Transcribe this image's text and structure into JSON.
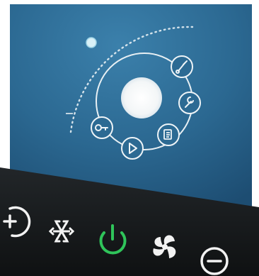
{
  "screen": {
    "dial": {
      "level": 0.25,
      "icons": [
        "brush-icon",
        "wrench-icon",
        "document-icon",
        "play-icon",
        "key-icon"
      ]
    }
  },
  "bottom_panel": {
    "buttons": [
      {
        "icon": "plus-icon",
        "color": "#f2f2f2"
      },
      {
        "icon": "snowflake-icon",
        "color": "#f2f2f2"
      },
      {
        "icon": "power-icon",
        "color": "#2fc45a"
      },
      {
        "icon": "fan-icon",
        "color": "#f2f2f2"
      },
      {
        "icon": "minus-icon",
        "color": "#f2f2f2"
      }
    ]
  },
  "colors": {
    "screen_blue": "#2f6d97",
    "panel_black": "#141618",
    "glow": "#f3f6f7",
    "power_green": "#2fc45a"
  }
}
